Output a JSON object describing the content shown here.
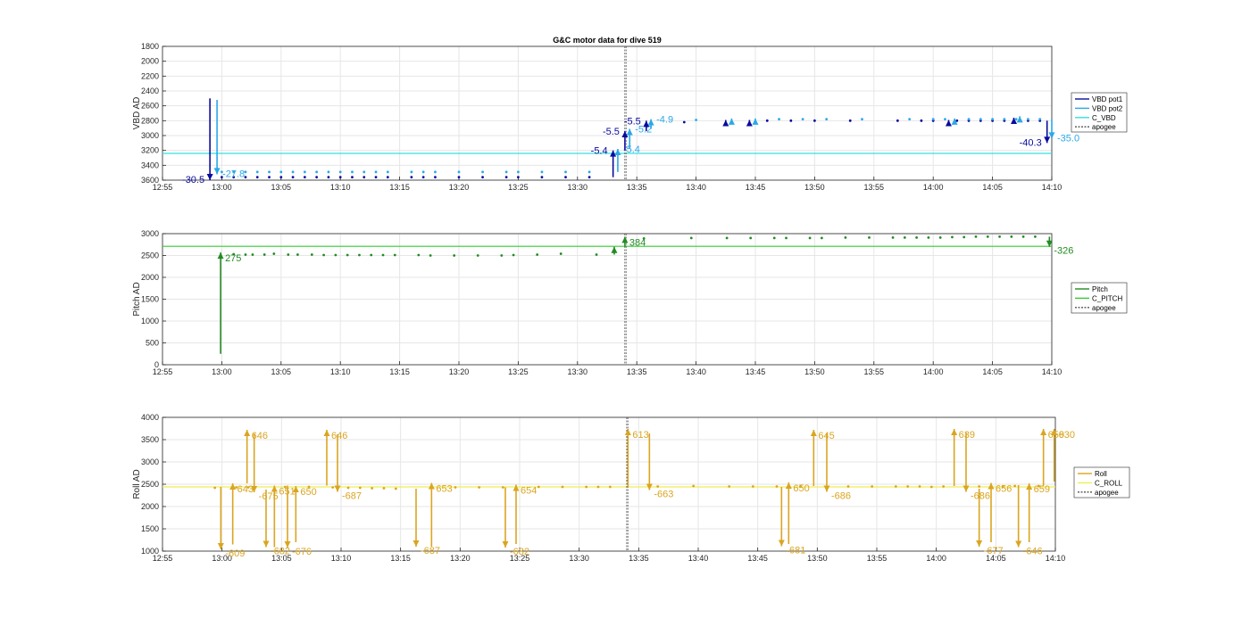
{
  "colors": {
    "vbd_pot1": "#0a0a9e",
    "vbd_pot2": "#2aa8e8",
    "c_vbd": "#33e0e0",
    "pitch": "#228b22",
    "c_pitch": "#33cc33",
    "roll": "#daa520",
    "c_roll": "#eeee55",
    "apogee": "#555555",
    "axis": "#262626"
  },
  "chart_data": [
    {
      "type": "scatter",
      "title": "G&C motor data for dive 519",
      "ylabel": "VBD AD",
      "xlim": [
        "12:55",
        "14:10"
      ],
      "ylim": [
        1800,
        3600
      ],
      "y_reversed": true,
      "grid": true,
      "legend_position": "right",
      "x_ticks": [
        "12:55",
        "13:00",
        "13:05",
        "13:10",
        "13:15",
        "13:20",
        "13:25",
        "13:30",
        "13:35",
        "13:40",
        "13:45",
        "13:50",
        "13:55",
        "14:00",
        "14:05",
        "14:10"
      ],
      "y_ticks": [
        "1800",
        "2000",
        "2200",
        "2400",
        "2600",
        "2800",
        "3000",
        "3200",
        "3400",
        "3600"
      ],
      "apogee_x": "13:34",
      "legend": [
        "VBD pot1",
        "VBD pot2",
        "C_VBD",
        "apogee"
      ],
      "c_line": 3240,
      "series": [
        {
          "name": "VBD pot1",
          "color_key": "vbd_pot1",
          "x": [
            "13:00",
            "13:01",
            "13:02",
            "13:03",
            "13:04",
            "13:05",
            "13:06",
            "13:07",
            "13:08",
            "13:09",
            "13:10",
            "13:11",
            "13:12",
            "13:13",
            "13:14",
            "13:16",
            "13:17",
            "13:18",
            "13:20",
            "13:22",
            "13:24",
            "13:25",
            "13:27",
            "13:29",
            "13:31",
            "13:39",
            "13:46",
            "13:48",
            "13:50",
            "13:53",
            "13:57",
            "13:59",
            "14:00",
            "14:02",
            "14:03",
            "14:04",
            "14:05",
            "14:06",
            "14:08",
            "14:09"
          ],
          "y": [
            3560,
            3560,
            3560,
            3560,
            3560,
            3560,
            3560,
            3560,
            3560,
            3560,
            3560,
            3560,
            3560,
            3560,
            3560,
            3560,
            3560,
            3560,
            3560,
            3560,
            3560,
            3560,
            3560,
            3560,
            3560,
            2820,
            2800,
            2800,
            2800,
            2800,
            2800,
            2800,
            2800,
            2800,
            2800,
            2800,
            2800,
            2800,
            2800,
            2800
          ]
        },
        {
          "name": "VBD pot2",
          "color_key": "vbd_pot2",
          "x": [
            "13:00",
            "13:01",
            "13:02",
            "13:03",
            "13:04",
            "13:05",
            "13:06",
            "13:07",
            "13:08",
            "13:09",
            "13:10",
            "13:11",
            "13:12",
            "13:13",
            "13:14",
            "13:16",
            "13:17",
            "13:18",
            "13:20",
            "13:22",
            "13:24",
            "13:25",
            "13:27",
            "13:29",
            "13:31",
            "13:40",
            "13:47",
            "13:49",
            "13:51",
            "13:54",
            "13:58",
            "14:00",
            "14:01",
            "14:03",
            "14:04",
            "14:05",
            "14:06",
            "14:07",
            "14:08",
            "14:09"
          ],
          "y": [
            3490,
            3490,
            3490,
            3490,
            3490,
            3490,
            3490,
            3490,
            3490,
            3490,
            3490,
            3490,
            3490,
            3490,
            3490,
            3490,
            3490,
            3490,
            3490,
            3490,
            3490,
            3490,
            3490,
            3490,
            3490,
            2790,
            2780,
            2780,
            2780,
            2780,
            2780,
            2780,
            2780,
            2780,
            2780,
            2780,
            2780,
            2780,
            2780,
            2780
          ]
        }
      ],
      "moves": [
        {
          "x": "12:59",
          "from": 2500,
          "to": 3600,
          "color_key": "vbd_pot1",
          "label": "-30.5",
          "label_color_key": "vbd_pot1"
        },
        {
          "x": "12:59.6",
          "from": 2520,
          "to": 3520,
          "color_key": "vbd_pot2",
          "label": "-27.8",
          "label_color_key": "vbd_pot2"
        },
        {
          "x": "13:33",
          "from": 3560,
          "to": 3200,
          "color_key": "vbd_pot1",
          "label": "-5.4",
          "label_color_key": "vbd_pot1"
        },
        {
          "x": "13:33.4",
          "from": 3490,
          "to": 3180,
          "color_key": "vbd_pot2",
          "label": "-5.4",
          "label_color_key": "vbd_pot2"
        },
        {
          "x": "13:34",
          "from": 3200,
          "to": 2940,
          "color_key": "vbd_pot1",
          "label": "-5.5",
          "label_color_key": "vbd_pot1"
        },
        {
          "x": "13:34.4",
          "from": 3180,
          "to": 2910,
          "color_key": "vbd_pot2",
          "label": "-5.2",
          "label_color_key": "vbd_pot2"
        },
        {
          "x": "13:35.8",
          "from": 2940,
          "to": 2800,
          "color_key": "vbd_pot1",
          "label": "-5.5",
          "label_color_key": "vbd_pot1"
        },
        {
          "x": "13:36.2",
          "from": 2910,
          "to": 2780,
          "color_key": "vbd_pot2",
          "label": "-4.9",
          "label_color_key": "vbd_pot2"
        },
        {
          "x": "13:42.5",
          "from": 2820,
          "to": 2790,
          "color_key": "vbd_pot1",
          "label": "",
          "label_color_key": "vbd_pot1"
        },
        {
          "x": "13:43",
          "from": 2800,
          "to": 2770,
          "color_key": "vbd_pot2",
          "label": "",
          "label_color_key": "vbd_pot2"
        },
        {
          "x": "13:44.5",
          "from": 2820,
          "to": 2790,
          "color_key": "vbd_pot1",
          "label": "",
          "label_color_key": "vbd_pot1"
        },
        {
          "x": "13:45",
          "from": 2800,
          "to": 2770,
          "color_key": "vbd_pot2",
          "label": "",
          "label_color_key": "vbd_pot2"
        },
        {
          "x": "14:01.3",
          "from": 2820,
          "to": 2790,
          "color_key": "vbd_pot1",
          "label": "",
          "label_color_key": "vbd_pot1"
        },
        {
          "x": "14:01.8",
          "from": 2800,
          "to": 2770,
          "color_key": "vbd_pot2",
          "label": "",
          "label_color_key": "vbd_pot2"
        },
        {
          "x": "14:06.8",
          "from": 2800,
          "to": 2760,
          "color_key": "vbd_pot1",
          "label": "",
          "label_color_key": "vbd_pot1"
        },
        {
          "x": "14:07.3",
          "from": 2780,
          "to": 2740,
          "color_key": "vbd_pot2",
          "label": "",
          "label_color_key": "vbd_pot2"
        },
        {
          "x": "14:09.6",
          "from": 2800,
          "to": 3100,
          "color_key": "vbd_pot1",
          "label": "-40.3",
          "label_color_key": "vbd_pot1"
        },
        {
          "x": "14:10.0",
          "from": 2780,
          "to": 3040,
          "color_key": "vbd_pot2",
          "label": "-35.0",
          "label_color_key": "vbd_pot2"
        }
      ]
    },
    {
      "type": "scatter",
      "title": "",
      "ylabel": "Pitch AD",
      "xlim": [
        "12:55",
        "14:10"
      ],
      "ylim": [
        0,
        3000
      ],
      "grid": true,
      "legend_position": "right",
      "x_ticks": [
        "12:55",
        "13:00",
        "13:05",
        "13:10",
        "13:15",
        "13:20",
        "13:25",
        "13:30",
        "13:35",
        "13:40",
        "13:45",
        "13:50",
        "13:55",
        "14:00",
        "14:05",
        "14:10"
      ],
      "y_ticks": [
        "0",
        "500",
        "1000",
        "1500",
        "2000",
        "2500",
        "3000"
      ],
      "apogee_x": "13:34",
      "legend": [
        "Pitch",
        "C_PITCH",
        "apogee"
      ],
      "c_line": 2710,
      "series": [
        {
          "name": "Pitch",
          "color_key": "pitch",
          "x": [
            "13:01",
            "13:02",
            "13:02.6",
            "13:03.6",
            "13:04.4",
            "13:05.6",
            "13:06.4",
            "13:07.6",
            "13:08.6",
            "13:09.6",
            "13:10.6",
            "13:11.6",
            "13:12.6",
            "13:13.6",
            "13:14.6",
            "13:16.6",
            "13:17.6",
            "13:19.6",
            "13:21.6",
            "13:23.6",
            "13:24.6",
            "13:26.6",
            "13:28.6",
            "13:31.6",
            "13:35.6",
            "13:39.6",
            "13:42.6",
            "13:44.6",
            "13:46.6",
            "13:47.6",
            "13:49.6",
            "13:50.6",
            "13:52.6",
            "13:54.6",
            "13:56.6",
            "13:57.6",
            "13:58.6",
            "13:59.6",
            "14:00.6",
            "14:01.6",
            "14:02.6",
            "14:03.6",
            "14:04.6",
            "14:05.6",
            "14:06.6",
            "14:07.6",
            "14:08.6"
          ],
          "y": [
            2530,
            2520,
            2520,
            2520,
            2540,
            2520,
            2520,
            2520,
            2510,
            2510,
            2510,
            2510,
            2510,
            2510,
            2510,
            2510,
            2500,
            2500,
            2500,
            2500,
            2510,
            2520,
            2540,
            2520,
            2890,
            2900,
            2900,
            2900,
            2900,
            2900,
            2900,
            2900,
            2910,
            2910,
            2910,
            2910,
            2910,
            2910,
            2910,
            2920,
            2920,
            2930,
            2930,
            2930,
            2930,
            2930,
            2930
          ]
        }
      ],
      "moves": [
        {
          "x": "12:59.9",
          "from": 250,
          "to": 2570,
          "color_key": "pitch",
          "label": "275",
          "label_color_key": "pitch"
        },
        {
          "x": "13:33.1",
          "from": 2520,
          "to": 2700,
          "color_key": "pitch",
          "label": "",
          "label_color_key": "pitch"
        },
        {
          "x": "13:34",
          "from": 2700,
          "to": 2930,
          "color_key": "pitch",
          "label": "384",
          "label_color_key": "pitch"
        },
        {
          "x": "14:09.8",
          "from": 2930,
          "to": 2700,
          "color_key": "pitch",
          "label": "-326",
          "label_color_key": "pitch"
        }
      ]
    },
    {
      "type": "scatter",
      "title": "",
      "ylabel": "Roll AD",
      "xlim": [
        "12:55",
        "14:10"
      ],
      "ylim": [
        1000,
        4000
      ],
      "grid": true,
      "legend_position": "right",
      "x_ticks": [
        "12:55",
        "13:00",
        "13:05",
        "13:10",
        "13:15",
        "13:20",
        "13:25",
        "13:30",
        "13:35",
        "13:40",
        "13:45",
        "13:50",
        "13:55",
        "14:00",
        "14:05",
        "14:10"
      ],
      "y_ticks": [
        "1000",
        "1500",
        "2000",
        "2500",
        "3000",
        "3500",
        "4000"
      ],
      "apogee_x": "13:34",
      "legend": [
        "Roll",
        "C_ROLL",
        "apogee"
      ],
      "c_line": 2440,
      "series": [
        {
          "name": "Roll",
          "color_key": "roll",
          "x": [
            "12:59.4",
            "13:01.2",
            "13:02.2",
            "13:05.3",
            "13:07.3",
            "13:09.3",
            "13:10.6",
            "13:11.6",
            "13:12.6",
            "13:13.6",
            "13:14.6",
            "13:19.6",
            "13:21.6",
            "13:23.6",
            "13:26.6",
            "13:28.6",
            "13:30.6",
            "13:31.6",
            "13:32.6",
            "13:36.6",
            "13:39.6",
            "13:42.6",
            "13:44.6",
            "13:46.6",
            "13:48.6",
            "13:52.6",
            "13:54.6",
            "13:56.6",
            "13:57.6",
            "13:58.6",
            "13:59.6",
            "14:00.6",
            "14:03.6",
            "14:05.6",
            "14:06.6",
            "14:08.6"
          ],
          "y": [
            2420,
            2430,
            2430,
            2440,
            2440,
            2430,
            2420,
            2420,
            2410,
            2410,
            2400,
            2430,
            2430,
            2430,
            2440,
            2440,
            2440,
            2440,
            2440,
            2450,
            2460,
            2450,
            2450,
            2450,
            2450,
            2450,
            2450,
            2450,
            2450,
            2450,
            2440,
            2450,
            2450,
            2450,
            2460,
            2460
          ]
        }
      ],
      "moves": [
        {
          "x": "12:59.9",
          "from": 2440,
          "to": 1040,
          "color_key": "roll",
          "label": "-609",
          "label_color_key": "roll"
        },
        {
          "x": "13:00.9",
          "from": 1150,
          "to": 2520,
          "color_key": "roll",
          "label": "643",
          "label_color_key": "roll"
        },
        {
          "x": "13:02.1",
          "from": 2520,
          "to": 3720,
          "color_key": "roll",
          "label": "646",
          "label_color_key": "roll"
        },
        {
          "x": "13:02.7",
          "from": 3640,
          "to": 2320,
          "color_key": "roll",
          "label": "-675",
          "label_color_key": "roll"
        },
        {
          "x": "13:03.7",
          "from": 2380,
          "to": 1090,
          "color_key": "roll",
          "label": "-682",
          "label_color_key": "roll"
        },
        {
          "x": "13:04.4",
          "from": 1090,
          "to": 2470,
          "color_key": "roll",
          "label": "651",
          "label_color_key": "roll"
        },
        {
          "x": "13:05.5",
          "from": 2470,
          "to": 1080,
          "color_key": "roll",
          "label": "-676",
          "label_color_key": "roll"
        },
        {
          "x": "13:06.2",
          "from": 1200,
          "to": 2460,
          "color_key": "roll",
          "label": "650",
          "label_color_key": "roll"
        },
        {
          "x": "13:08.8",
          "from": 2470,
          "to": 3720,
          "color_key": "roll",
          "label": "646",
          "label_color_key": "roll"
        },
        {
          "x": "13:09.7",
          "from": 3620,
          "to": 2330,
          "color_key": "roll",
          "label": "-687",
          "label_color_key": "roll"
        },
        {
          "x": "13:16.3",
          "from": 2400,
          "to": 1100,
          "color_key": "roll",
          "label": "-687",
          "label_color_key": "roll"
        },
        {
          "x": "13:17.6",
          "from": 1100,
          "to": 2530,
          "color_key": "roll",
          "label": "653",
          "label_color_key": "roll"
        },
        {
          "x": "13:23.8",
          "from": 2430,
          "to": 1080,
          "color_key": "roll",
          "label": "-682",
          "label_color_key": "roll"
        },
        {
          "x": "13:24.7",
          "from": 1160,
          "to": 2490,
          "color_key": "roll",
          "label": "654",
          "label_color_key": "roll"
        },
        {
          "x": "13:34.1",
          "from": 2440,
          "to": 3740,
          "color_key": "roll",
          "label": "613",
          "label_color_key": "roll"
        },
        {
          "x": "13:35.9",
          "from": 3640,
          "to": 2370,
          "color_key": "roll",
          "label": "-663",
          "label_color_key": "roll"
        },
        {
          "x": "13:47.0",
          "from": 2440,
          "to": 1110,
          "color_key": "roll",
          "label": "-681",
          "label_color_key": "roll"
        },
        {
          "x": "13:47.6",
          "from": 1160,
          "to": 2540,
          "color_key": "roll",
          "label": "650",
          "label_color_key": "roll"
        },
        {
          "x": "13:49.7",
          "from": 2460,
          "to": 3720,
          "color_key": "roll",
          "label": "645",
          "label_color_key": "roll"
        },
        {
          "x": "13:50.8",
          "from": 3640,
          "to": 2330,
          "color_key": "roll",
          "label": "-686",
          "label_color_key": "roll"
        },
        {
          "x": "14:01.5",
          "from": 2460,
          "to": 3740,
          "color_key": "roll",
          "label": "639",
          "label_color_key": "roll"
        },
        {
          "x": "14:02.5",
          "from": 3660,
          "to": 2330,
          "color_key": "roll",
          "label": "-686",
          "label_color_key": "roll"
        },
        {
          "x": "14:03.6",
          "from": 2400,
          "to": 1100,
          "color_key": "roll",
          "label": "-677",
          "label_color_key": "roll"
        },
        {
          "x": "14:04.6",
          "from": 1200,
          "to": 2530,
          "color_key": "roll",
          "label": "656",
          "label_color_key": "roll"
        },
        {
          "x": "14:06.9",
          "from": 2480,
          "to": 1090,
          "color_key": "roll",
          "label": "-646",
          "label_color_key": "roll"
        },
        {
          "x": "14:07.8",
          "from": 1200,
          "to": 2520,
          "color_key": "roll",
          "label": "659",
          "label_color_key": "roll"
        },
        {
          "x": "14:09.0",
          "from": 2470,
          "to": 3740,
          "color_key": "roll",
          "label": "659",
          "label_color_key": "roll"
        },
        {
          "x": "14:09.9",
          "from": 2560,
          "to": 3740,
          "color_key": "roll",
          "label": "630",
          "label_color_key": "roll"
        }
      ]
    }
  ]
}
